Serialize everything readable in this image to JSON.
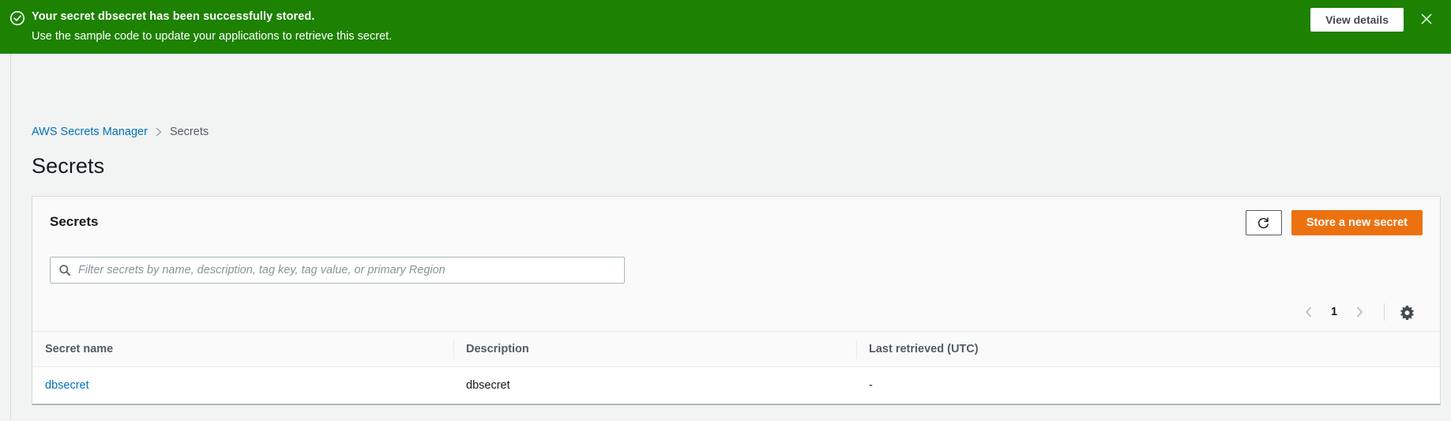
{
  "flash": {
    "icon": "check-circle-icon",
    "title": "Your secret dbsecret has been successfully stored.",
    "subtitle": "Use the sample code to update your applications to retrieve this secret.",
    "view_details_label": "View details",
    "close_icon": "close-icon",
    "background_color": "#1d8102"
  },
  "breadcrumb": {
    "root_label": "AWS Secrets Manager",
    "separator_icon": "chevron-right-icon",
    "current_label": "Secrets"
  },
  "page": {
    "title": "Secrets"
  },
  "card": {
    "title": "Secrets",
    "refresh_icon": "refresh-icon",
    "primary_button_label": "Store a new secret",
    "primary_button_color": "#ec7211"
  },
  "search": {
    "icon": "search-icon",
    "value": "",
    "placeholder": "Filter secrets by name, description, tag key, tag value, or primary Region"
  },
  "pagination": {
    "prev_icon": "chevron-left-icon",
    "page_number": "1",
    "next_icon": "chevron-right-icon",
    "settings_icon": "gear-icon"
  },
  "table": {
    "columns": [
      {
        "label": "Secret name"
      },
      {
        "label": "Description"
      },
      {
        "label": "Last retrieved (UTC)"
      }
    ],
    "rows": [
      {
        "name": "dbsecret",
        "description": "dbsecret",
        "last_retrieved": "-"
      }
    ]
  }
}
